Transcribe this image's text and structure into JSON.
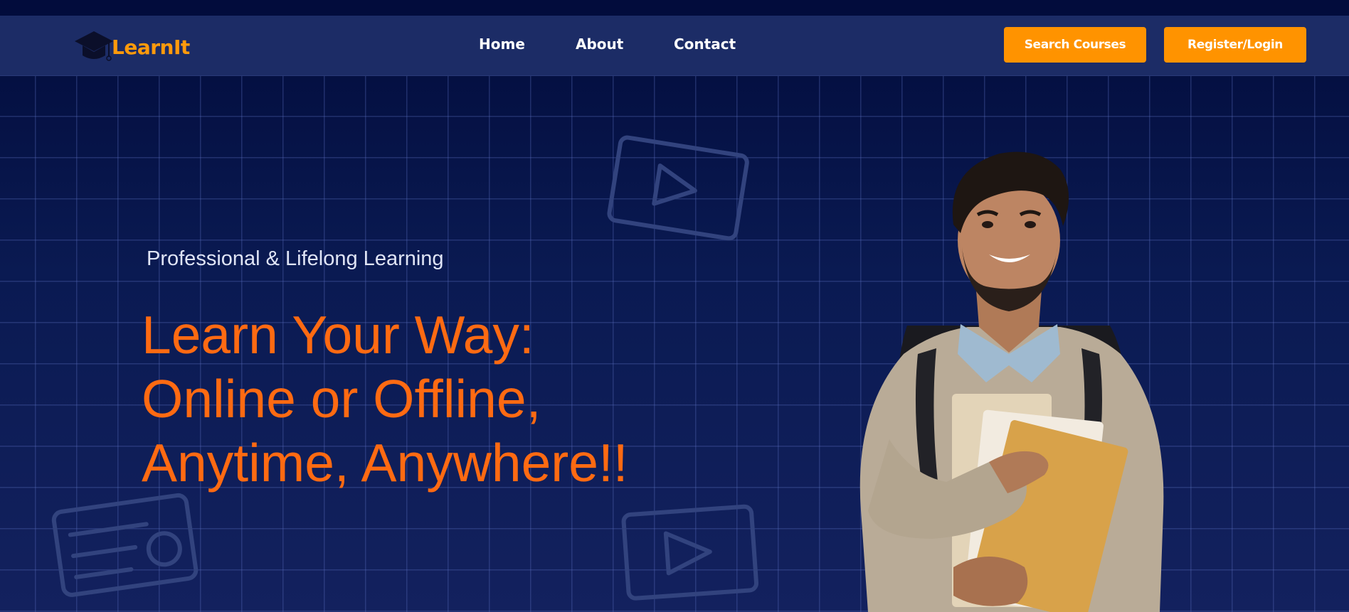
{
  "brand": {
    "name": "LearnIt",
    "logo_icon": "graduation-cap-icon",
    "accent": "#ff9300"
  },
  "nav": {
    "links": [
      {
        "label": "Home"
      },
      {
        "label": "About"
      },
      {
        "label": "Contact"
      }
    ],
    "search_button": "Search Courses",
    "register_button": "Register/Login"
  },
  "hero": {
    "subtitle": "Professional & Lifelong Learning",
    "headline": [
      "Learn Your Way:",
      "Online or Offline,",
      "Anytime, Anywhere!!"
    ],
    "headline_color": "#ff6a12",
    "background": "#0a1446"
  }
}
